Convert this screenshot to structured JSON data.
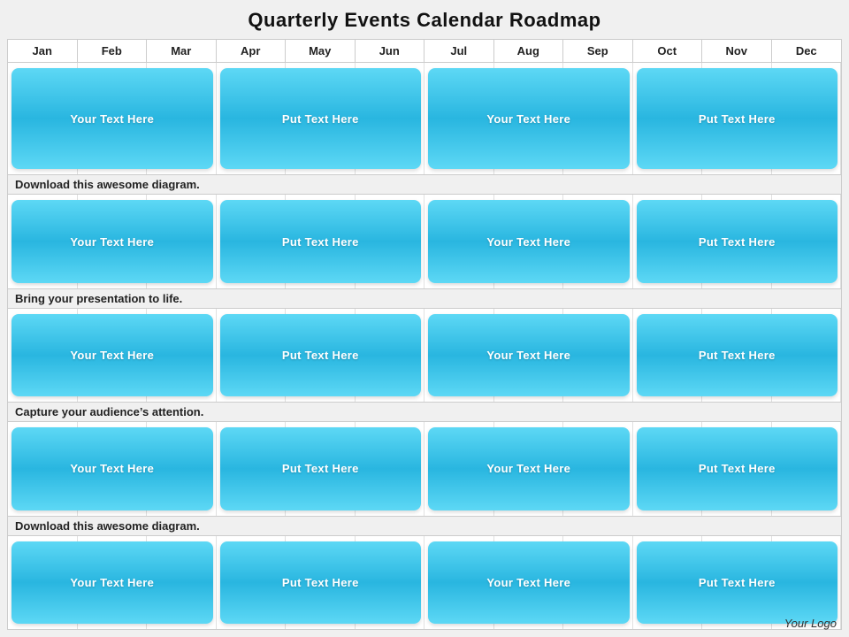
{
  "title": "Quarterly Events Calendar Roadmap",
  "months": [
    "Jan",
    "Feb",
    "Mar",
    "Apr",
    "May",
    "Jun",
    "Jul",
    "Aug",
    "Sep",
    "Oct",
    "Nov",
    "Dec"
  ],
  "logo": "Your Logo",
  "rows": [
    {
      "label": null,
      "events": [
        {
          "text": "Your  Text Here",
          "startCol": 0,
          "span": 3
        },
        {
          "text": "Put Text  Here",
          "startCol": 3,
          "span": 3
        },
        {
          "text": "Your  Text Here",
          "startCol": 6,
          "span": 3
        },
        {
          "text": "Put Text  Here",
          "startCol": 9,
          "span": 3
        }
      ]
    },
    {
      "label": "Download this awesome diagram.",
      "events": [
        {
          "text": "Your Text Here",
          "startCol": 0,
          "span": 3
        },
        {
          "text": "Put Text  Here",
          "startCol": 3,
          "span": 3
        },
        {
          "text": "Your Text Here",
          "startCol": 6,
          "span": 3
        },
        {
          "text": "Put Text  Here",
          "startCol": 9,
          "span": 3
        }
      ]
    },
    {
      "label": "Bring your presentation to life.",
      "events": [
        {
          "text": "Your Text Here",
          "startCol": 0,
          "span": 3
        },
        {
          "text": "Put Text  Here",
          "startCol": 3,
          "span": 3
        },
        {
          "text": "Your Text Here",
          "startCol": 6,
          "span": 3
        },
        {
          "text": "Put Text  Here",
          "startCol": 9,
          "span": 3
        }
      ]
    },
    {
      "label": "Capture your audience’s attention.",
      "events": [
        {
          "text": "Your Text Here",
          "startCol": 0,
          "span": 3
        },
        {
          "text": "Put Text  Here",
          "startCol": 3,
          "span": 3
        },
        {
          "text": "Your Text Here",
          "startCol": 6,
          "span": 3
        },
        {
          "text": "Put Text  Here",
          "startCol": 9,
          "span": 3
        }
      ]
    },
    {
      "label": "Download this awesome diagram.",
      "events": [
        {
          "text": "Your  Text Here",
          "startCol": 0,
          "span": 3
        },
        {
          "text": "Put Text  Here",
          "startCol": 3,
          "span": 3
        },
        {
          "text": "Your  Text Here",
          "startCol": 6,
          "span": 3
        },
        {
          "text": "Put Text  Here",
          "startCol": 9,
          "span": 3
        }
      ]
    }
  ]
}
